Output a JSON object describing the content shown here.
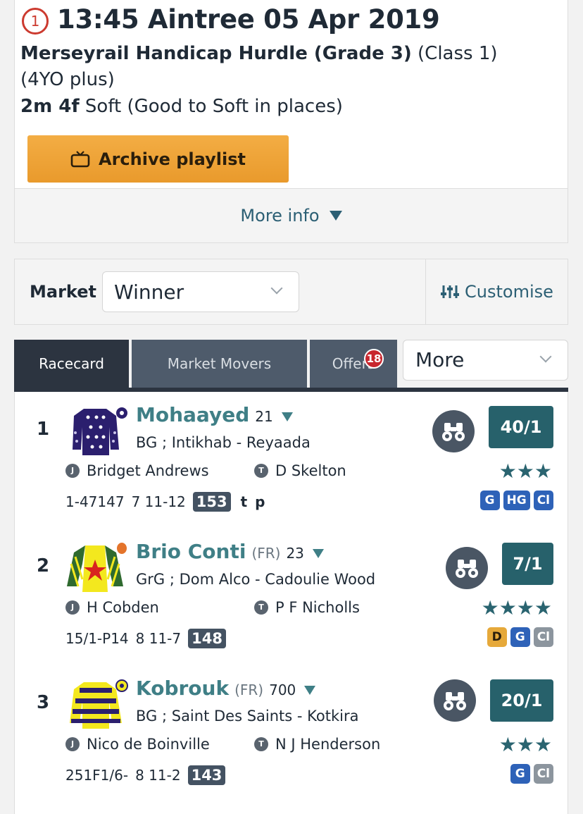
{
  "race": {
    "number": "1",
    "time_course_date": "13:45 Aintree 05 Apr 2019",
    "name_bold": "Merseyrail Handicap Hurdle (Grade 3)",
    "name_rest": " (Class 1) (4YO plus)",
    "distance": "2m 4f",
    "going": " Soft (Good to Soft in places)",
    "archive_label": "Archive playlist",
    "more_info_label": "More info"
  },
  "market": {
    "label": "Market",
    "selected": "Winner",
    "customise_label": "Customise"
  },
  "tabs": {
    "racecard": "Racecard",
    "market_movers": "Market Movers",
    "offers": "Offers",
    "offers_count": "18",
    "more": "More"
  },
  "runners": [
    {
      "number": "1",
      "name": "Mohaayed",
      "country": "",
      "days": "21",
      "breeding": "BG ; Intikhab - Reyaada",
      "jockey_icon": "J",
      "jockey": "Bridget Andrews",
      "trainer_icon": "T",
      "trainer": "D Skelton",
      "form": "1-47147",
      "age_weight": "7 11-12",
      "rating": "153",
      "headgear": "t p",
      "odds": "40/1",
      "stars": "★★★",
      "badges": [
        {
          "label": "G",
          "color": "#2e62b8"
        },
        {
          "label": "HG",
          "color": "#2e62b8"
        },
        {
          "label": "Cl",
          "color": "#2e62b8"
        }
      ]
    },
    {
      "number": "2",
      "name": "Brio Conti",
      "country": "(FR)",
      "days": "23",
      "breeding": "GrG ; Dom Alco - Cadoulie Wood",
      "jockey_icon": "J",
      "jockey": "H Cobden",
      "trainer_icon": "T",
      "trainer": "P F Nicholls",
      "form": "15/1-P14",
      "age_weight": "8 11-7",
      "rating": "148",
      "headgear": "",
      "odds": "7/1",
      "stars": "★★★★",
      "badges": [
        {
          "label": "D",
          "color": "#e6a93a"
        },
        {
          "label": "G",
          "color": "#2e62b8"
        },
        {
          "label": "Cl",
          "color": "#8c959e"
        }
      ]
    },
    {
      "number": "3",
      "name": "Kobrouk",
      "country": "(FR)",
      "days": "700",
      "breeding": "BG ; Saint Des Saints - Kotkira",
      "jockey_icon": "J",
      "jockey": "Nico de Boinville",
      "trainer_icon": "T",
      "trainer": "N J Henderson",
      "form": "251F1/6-",
      "age_weight": "8 11-2",
      "rating": "143",
      "headgear": "",
      "odds": "20/1",
      "stars": "★★★",
      "badges": [
        {
          "label": "G",
          "color": "#2e62b8"
        },
        {
          "label": "Cl",
          "color": "#8c959e"
        }
      ]
    }
  ]
}
